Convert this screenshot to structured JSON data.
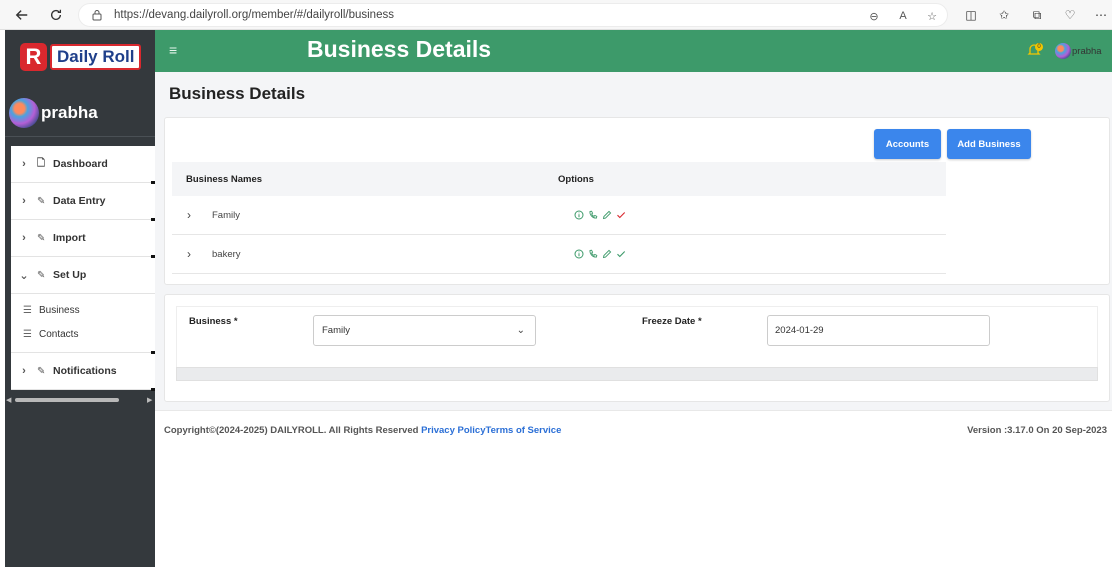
{
  "browser": {
    "url": "https://devang.dailyroll.org/member/#/dailyroll/business"
  },
  "app": {
    "logo_letter": "R",
    "logo_text": "Daily Roll",
    "page_heading": "Business Details"
  },
  "user": {
    "name": "prabha",
    "notification_count": "0"
  },
  "sidebar": {
    "items": [
      {
        "label": "Dashboard",
        "icon": "document-icon"
      },
      {
        "label": "Data Entry",
        "icon": "pencil-icon"
      },
      {
        "label": "Import",
        "icon": "pencil-icon"
      },
      {
        "label": "Set Up",
        "icon": "pencil-icon"
      },
      {
        "label": "Notifications",
        "icon": "pencil-icon"
      }
    ],
    "setup_subitems": [
      {
        "label": "Business",
        "icon": "list-icon"
      },
      {
        "label": "Contacts",
        "icon": "list-icon"
      }
    ]
  },
  "page": {
    "title": "Business Details",
    "buttons": {
      "accounts": "Accounts",
      "add_business": "Add Business"
    },
    "table": {
      "headers": [
        "Business Names",
        "Options"
      ],
      "rows": [
        {
          "name": "Family"
        },
        {
          "name": "bakery"
        }
      ]
    },
    "form": {
      "business_label": "Business *",
      "business_value": "Family",
      "freeze_label": "Freeze Date *",
      "freeze_value": "2024-01-29"
    }
  },
  "footer": {
    "copyright": "Copyright©(2024-2025) DAILYROLL. All Rights Reserved",
    "privacy": "Privacy Policy",
    "terms": "Terms of Service",
    "version": "Version :3.17.0 On 20 Sep-2023"
  },
  "colors": {
    "topbar": "#3d9a6a",
    "sidebar": "#34393d",
    "button": "#3b86ec",
    "option_icons": "#3d9a6a",
    "check_icon": "#d9282e"
  }
}
